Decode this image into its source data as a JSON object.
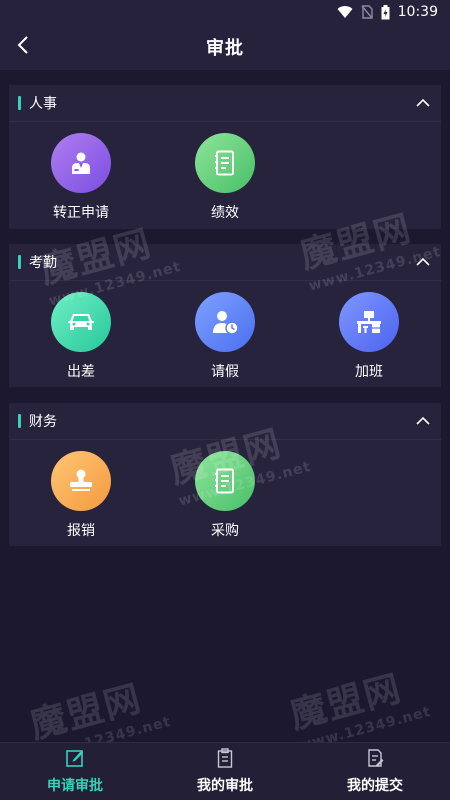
{
  "status_bar": {
    "time": "10:39"
  },
  "header": {
    "title": "审批"
  },
  "sections": [
    {
      "title": "人事",
      "items": [
        {
          "label": "转正申请",
          "icon": "person-badge-icon",
          "color_from": "#b07df0",
          "color_to": "#7a4fe0"
        },
        {
          "label": "绩效",
          "icon": "notebook-icon",
          "color_from": "#8ee59a",
          "color_to": "#48bf68"
        }
      ]
    },
    {
      "title": "考勤",
      "items": [
        {
          "label": "出差",
          "icon": "car-icon",
          "color_from": "#6ff0c4",
          "color_to": "#27c79b"
        },
        {
          "label": "请假",
          "icon": "person-clock-icon",
          "color_from": "#7fa1ff",
          "color_to": "#4a6ff0"
        },
        {
          "label": "加班",
          "icon": "desk-icon",
          "color_from": "#7f97ff",
          "color_to": "#4c63ef"
        }
      ]
    },
    {
      "title": "财务",
      "items": [
        {
          "label": "报销",
          "icon": "stamp-icon",
          "color_from": "#ffc574",
          "color_to": "#f49a3f"
        },
        {
          "label": "采购",
          "icon": "notebook-icon",
          "color_from": "#8ee59a",
          "color_to": "#48bf68"
        }
      ]
    }
  ],
  "tabs": [
    {
      "label": "申请审批",
      "icon": "edit-icon",
      "active": true
    },
    {
      "label": "我的审批",
      "icon": "clipboard-icon",
      "active": false
    },
    {
      "label": "我的提交",
      "icon": "document-icon",
      "active": false
    }
  ],
  "watermark": {
    "brand": "魔盟网",
    "url": "www.12349.net"
  },
  "colors": {
    "accent": "#36d1b7",
    "background": "#1b1830",
    "panel": "#27233d"
  }
}
